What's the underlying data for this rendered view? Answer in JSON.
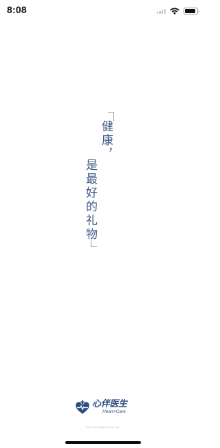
{
  "status_bar": {
    "time": "8:08",
    "signal_icon": "cellular-signal-icon",
    "wifi_icon": "wifi-icon",
    "battery_icon": "battery-icon",
    "battery_level": 0.9
  },
  "slogan": {
    "line1": "健康，",
    "line2": "是最好的礼物"
  },
  "logo": {
    "icon": "heart-care-logo-icon",
    "name_cn": "心伴医生",
    "name_en": "Heart+Care",
    "brand_color": "#2d4d83"
  },
  "footer": {
    "website": "www.xinbanyisheng.com"
  },
  "colors": {
    "background": "#ffffff",
    "slogan": "#3e5b86",
    "bracket": "#8f9aa8"
  }
}
